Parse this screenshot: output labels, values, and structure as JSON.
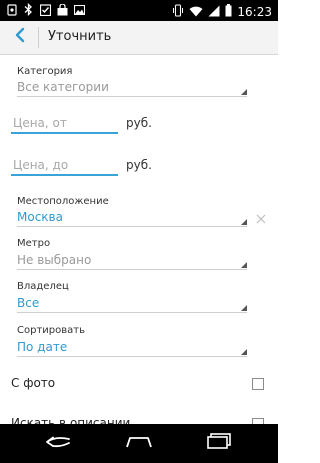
{
  "status_bar": {
    "time": "16:23",
    "left_icons": [
      "notification-icon",
      "bluetooth-icon",
      "checklist-icon",
      "shopping-bag-icon",
      "image-icon"
    ],
    "right_icons": [
      "vibrate-icon",
      "wifi-icon",
      "signal-icon",
      "battery-icon"
    ]
  },
  "action_bar": {
    "title": "Уточнить"
  },
  "filters": {
    "category": {
      "label": "Категория",
      "value": "Все категории"
    },
    "price_from": {
      "placeholder": "Цена, от",
      "unit": "руб."
    },
    "price_to": {
      "placeholder": "Цена, до",
      "unit": "руб."
    },
    "location": {
      "label": "Местоположение",
      "value": "Москва"
    },
    "metro": {
      "label": "Метро",
      "value": "Не выбрано"
    },
    "owner": {
      "label": "Владелец",
      "value": "Все"
    },
    "sort": {
      "label": "Сортировать",
      "value": "По дате"
    },
    "with_photo": {
      "label": "С фото",
      "checked": false
    },
    "search_description": {
      "label": "Искать в описании",
      "checked": false
    }
  },
  "colors": {
    "accent": "#2f9bd0",
    "input_underline": "#3aa3d8",
    "status_bar": "#000000",
    "nav_bar": "#000000"
  },
  "nav_bar": {
    "icons": [
      "back-nav-icon",
      "home-icon",
      "recent-apps-icon"
    ]
  }
}
